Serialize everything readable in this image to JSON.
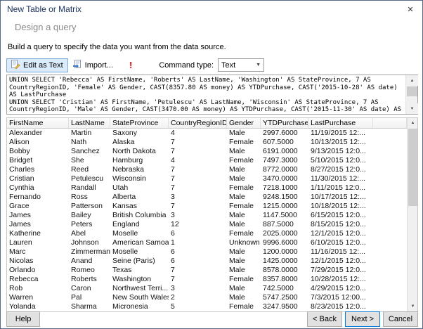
{
  "window": {
    "title": "New Table or Matrix"
  },
  "header": {
    "title": "Design a query",
    "subtitle": "Build a query to specify the data you want from the data source."
  },
  "toolbar": {
    "edit_as_text_label": "Edit as Text",
    "import_label": "Import...",
    "command_type_label": "Command type:",
    "command_type_value": "Text"
  },
  "icons": {
    "close": "×",
    "dropdown": "▼",
    "run": "!",
    "scroll_up": "▲",
    "scroll_down": "▼"
  },
  "query_text": "UNION SELECT 'Rebecca' AS FirstName, 'Roberts' AS LastName, 'Washington' AS StateProvince, 7 AS\nCountryRegionID, 'Female' AS Gender, CAST(8357.80 AS money) AS YTDPurchase, CAST('2015-10-28' AS date)\nAS LastPurchase\nUNION SELECT 'Cristian' AS FirstName, 'Petulescu' AS LastName, 'Wisconsin' AS StateProvince, 7 AS\nCountryRegionID, 'Male' AS Gender, CAST(3470.00 AS money) AS YTDPurchase, CAST('2015-11-30' AS date) AS",
  "grid": {
    "columns": [
      "FirstName",
      "LastName",
      "StateProvince",
      "CountryRegionID",
      "Gender",
      "YTDPurchase",
      "LastPurchase"
    ],
    "rows": [
      [
        "Alexander",
        "Martin",
        "Saxony",
        "4",
        "Male",
        "2997.6000",
        "11/19/2015 12:..."
      ],
      [
        "Alison",
        "Nath",
        "Alaska",
        "7",
        "Female",
        "607.5000",
        "10/13/2015 12:..."
      ],
      [
        "Bobby",
        "Sanchez",
        "North Dakota",
        "7",
        "Male",
        "6191.0000",
        "9/13/2015 12:0..."
      ],
      [
        "Bridget",
        "She",
        "Hamburg",
        "4",
        "Female",
        "7497.3000",
        "5/10/2015 12:0..."
      ],
      [
        "Charles",
        "Reed",
        "Nebraska",
        "7",
        "Male",
        "8772.0000",
        "8/27/2015 12:0..."
      ],
      [
        "Cristian",
        "Petulescu",
        "Wisconsin",
        "7",
        "Male",
        "3470.0000",
        "11/30/2015 12:..."
      ],
      [
        "Cynthia",
        "Randall",
        "Utah",
        "7",
        "Female",
        "7218.1000",
        "1/11/2015 12:0..."
      ],
      [
        "Fernando",
        "Ross",
        "Alberta",
        "3",
        "Male",
        "9248.1500",
        "10/17/2015 12:..."
      ],
      [
        "Grace",
        "Patterson",
        "Kansas",
        "7",
        "Female",
        "1215.0000",
        "10/18/2015 12:..."
      ],
      [
        "James",
        "Bailey",
        "British Columbia",
        "3",
        "Male",
        "1147.5000",
        "6/15/2015 12:0..."
      ],
      [
        "James",
        "Peters",
        "England",
        "12",
        "Male",
        "887.5000",
        "8/15/2015 12:0..."
      ],
      [
        "Katherine",
        "Abel",
        "Moselle",
        "6",
        "Female",
        "2025.0000",
        "12/1/2015 12:0..."
      ],
      [
        "Lauren",
        "Johnson",
        "American Samoa",
        "1",
        "Unknown",
        "9996.6000",
        "6/10/2015 12:0..."
      ],
      [
        "Marc",
        "Zimmerman",
        "Moselle",
        "6",
        "Male",
        "1200.0000",
        "11/16/2015 12:..."
      ],
      [
        "Nicolas",
        "Anand",
        "Seine (Paris)",
        "6",
        "Male",
        "1425.0000",
        "12/1/2015 12:0..."
      ],
      [
        "Orlando",
        "Romeo",
        "Texas",
        "7",
        "Male",
        "8578.0000",
        "7/29/2015 12:0..."
      ],
      [
        "Rebecca",
        "Roberts",
        "Washington",
        "7",
        "Female",
        "8357.8000",
        "10/28/2015 12:..."
      ],
      [
        "Rob",
        "Caron",
        "Northwest Terri...",
        "3",
        "Male",
        "742.5000",
        "4/29/2015 12:0..."
      ],
      [
        "Warren",
        "Pal",
        "New South Wales",
        "2",
        "Male",
        "5747.2500",
        "7/3/2015 12:00..."
      ],
      [
        "Yolanda",
        "Sharma",
        "Micronesia",
        "5",
        "Female",
        "3247.9500",
        "8/23/2015 12:0..."
      ]
    ]
  },
  "footer": {
    "help_label": "Help",
    "back_label": "< Back",
    "next_label": "Next >",
    "cancel_label": "Cancel"
  }
}
